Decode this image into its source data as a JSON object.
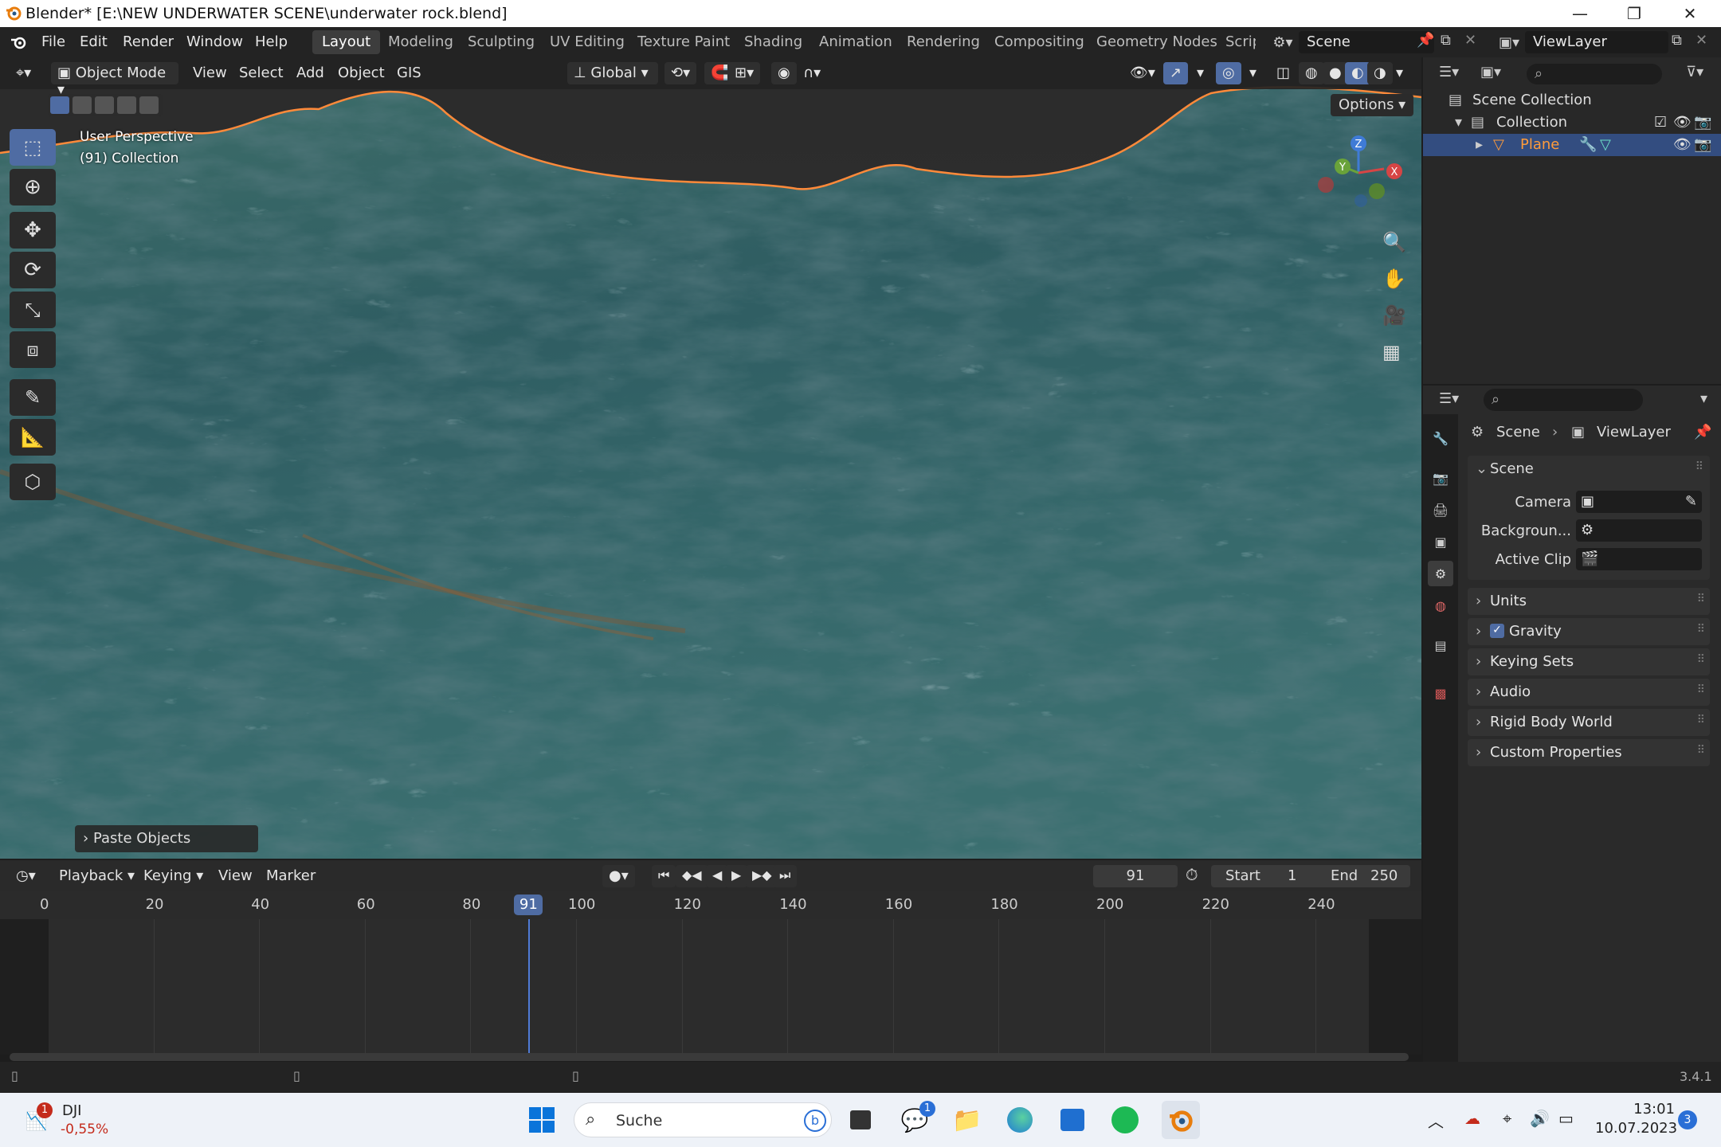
{
  "window": {
    "title": "Blender* [E:\\NEW UNDERWATER SCENE\\underwater rock.blend]"
  },
  "menubar": {
    "items": [
      "File",
      "Edit",
      "Render",
      "Window",
      "Help"
    ]
  },
  "workspaces": [
    "Layout",
    "Modeling",
    "Sculpting",
    "UV Editing",
    "Texture Paint",
    "Shading",
    "Animation",
    "Rendering",
    "Compositing",
    "Geometry Nodes",
    "Scrip"
  ],
  "active_workspace": "Layout",
  "scene_field": "Scene",
  "viewlayer_field": "ViewLayer",
  "viewport_header": {
    "mode": "Object Mode",
    "menus": [
      "View",
      "Select",
      "Add",
      "Object",
      "GIS"
    ],
    "orientation": "Global",
    "options": "Options"
  },
  "viewport": {
    "perspective": "User Perspective",
    "collection_info": "(91) Collection",
    "gizmo": {
      "z": "Z",
      "y": "Y",
      "x": "X"
    },
    "operator_panel": "Paste Objects"
  },
  "timeline": {
    "menus": [
      "Playback",
      "Keying",
      "View",
      "Marker"
    ],
    "current_frame": "91",
    "start_label": "Start",
    "start_value": "1",
    "end_label": "End",
    "end_value": "250",
    "ticks": [
      "0",
      "20",
      "40",
      "60",
      "80",
      "100",
      "120",
      "140",
      "160",
      "180",
      "200",
      "220",
      "240"
    ],
    "playhead": "91"
  },
  "outliner": {
    "root": "Scene Collection",
    "collection": "Collection",
    "object": "Plane"
  },
  "properties": {
    "breadcrumb_scene": "Scene",
    "breadcrumb_layer": "ViewLayer",
    "section": "Scene",
    "fields": [
      {
        "label": "Camera"
      },
      {
        "label": "Backgroun..."
      },
      {
        "label": "Active Clip"
      }
    ],
    "panels": [
      "Units",
      "Gravity",
      "Keying Sets",
      "Audio",
      "Rigid Body World",
      "Custom Properties"
    ]
  },
  "statusbar": {
    "version": "3.4.1"
  },
  "taskbar": {
    "stock_name": "DJI",
    "stock_change": "-0,55%",
    "stock_badge": "1",
    "search_placeholder": "Suche",
    "chat_badge": "1",
    "time": "13:01",
    "date": "10.07.2023",
    "notif_count": "3"
  },
  "colors": {
    "accent": "#4f6ca3",
    "selected_orange": "#ff9b3a",
    "panel": "#2a2a2a"
  }
}
